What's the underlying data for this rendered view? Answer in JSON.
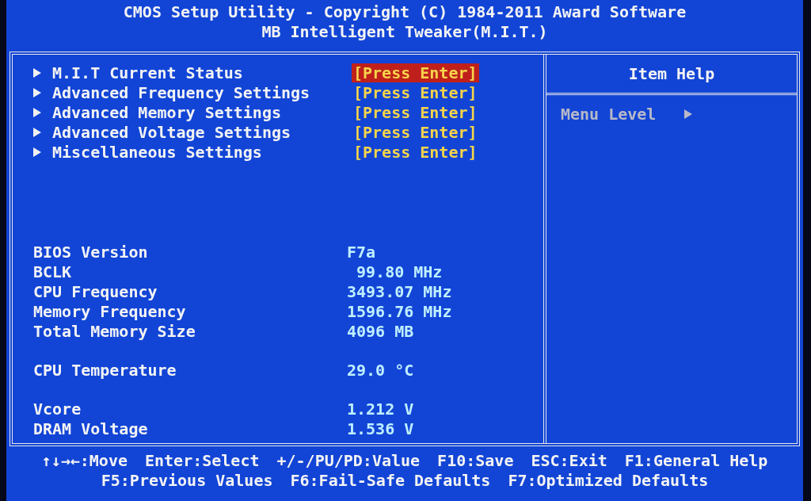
{
  "header": {
    "title": "CMOS Setup Utility - Copyright (C) 1984-2011 Award Software",
    "subtitle": "MB Intelligent Tweaker(M.I.T.)"
  },
  "menu_items": [
    {
      "label": "M.I.T Current Status",
      "value": "[Press Enter]",
      "selected": true
    },
    {
      "label": "Advanced Frequency Settings",
      "value": "[Press Enter]",
      "selected": false
    },
    {
      "label": "Advanced Memory Settings",
      "value": "[Press Enter]",
      "selected": false
    },
    {
      "label": "Advanced Voltage Settings",
      "value": "[Press Enter]",
      "selected": false
    },
    {
      "label": "Miscellaneous Settings",
      "value": "[Press Enter]",
      "selected": false
    }
  ],
  "info_sections": [
    {
      "rows": [
        {
          "label": "BIOS Version",
          "value": "F7a"
        },
        {
          "label": "BCLK",
          "value": " 99.80 MHz"
        },
        {
          "label": "CPU Frequency",
          "value": "3493.07 MHz"
        },
        {
          "label": "Memory Frequency",
          "value": "1596.76 MHz"
        },
        {
          "label": "Total Memory Size",
          "value": "4096 MB"
        }
      ]
    },
    {
      "rows": [
        {
          "label": "CPU Temperature",
          "value": "29.0 °C"
        }
      ]
    },
    {
      "rows": [
        {
          "label": "Vcore",
          "value": "1.212 V"
        },
        {
          "label": "DRAM Voltage",
          "value": "1.536 V"
        }
      ]
    }
  ],
  "item_help": {
    "title": "Item Help",
    "menu_level_label": "Menu Level"
  },
  "footer": [
    [
      "↑↓→←:Move",
      "Enter:Select",
      "+/-/PU/PD:Value",
      "F10:Save",
      "ESC:Exit",
      "F1:General Help"
    ],
    [
      "F5:Previous Values",
      "F6:Fail-Safe Defaults",
      "F7:Optimized Defaults"
    ]
  ]
}
